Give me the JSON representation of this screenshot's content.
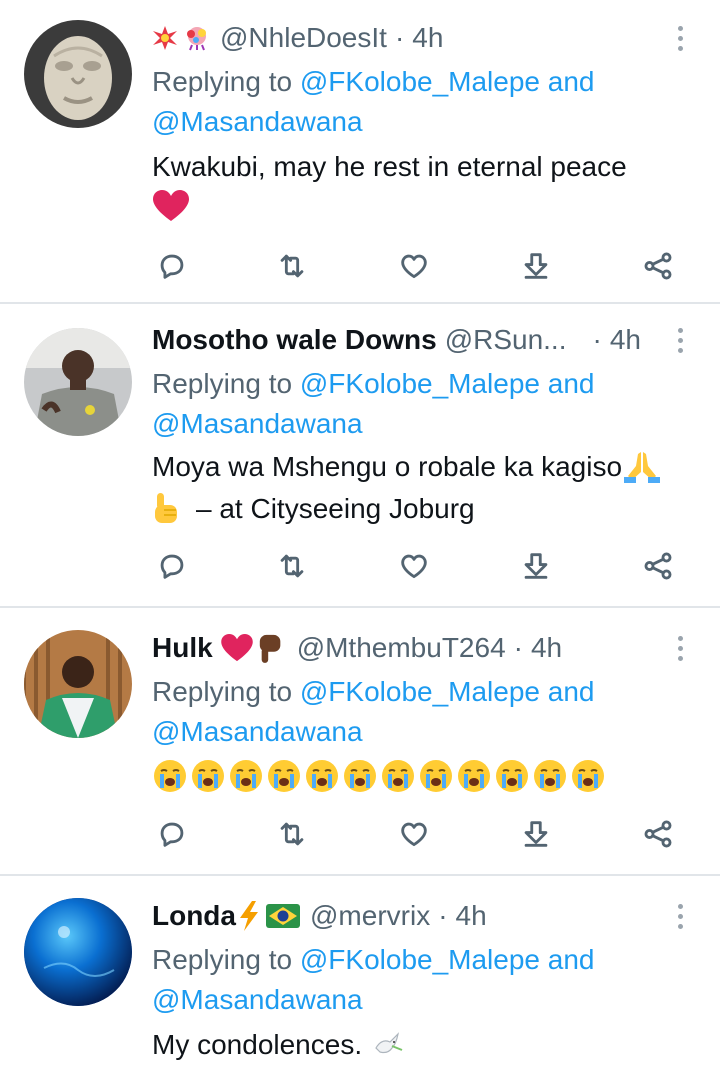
{
  "tweets": [
    {
      "display_name": "",
      "handle": "@NhleDoesIt",
      "time": "4h",
      "reply_prefix": "Replying to",
      "reply_to_1": "@FKolobe_Malepe",
      "reply_and": "and",
      "reply_to_2": "@Masandawana",
      "text_line1": "Kwakubi, may he rest in eternal peace",
      "text_line2": ""
    },
    {
      "display_name": "Mosotho wale Downs",
      "handle": "@RSun...",
      "time": "4h",
      "reply_prefix": "Replying to",
      "reply_to_1": "@FKolobe_Malepe",
      "reply_and": "and",
      "reply_to_2": "@Masandawana",
      "text_line1": "Moya wa Mshengu o robale ka kagiso",
      "text_line2": "– at Cityseeing Joburg"
    },
    {
      "display_name": "Hulk",
      "handle": "@MthembuT264",
      "time": "4h",
      "reply_prefix": "Replying to",
      "reply_to_1": "@FKolobe_Malepe",
      "reply_and": "and",
      "reply_to_2": "@Masandawana",
      "text_line1": "",
      "text_line2": ""
    },
    {
      "display_name": "Londa",
      "handle": "@mervrix",
      "time": "4h",
      "reply_prefix": "Replying to",
      "reply_to_1": "@FKolobe_Malepe",
      "reply_and": "and",
      "reply_to_2": "@Masandawana",
      "text_line1": "My condolences.",
      "text_line2": ""
    }
  ],
  "separator": "·",
  "icons": {
    "reply": "reply-icon",
    "retweet": "retweet-icon",
    "like": "like-icon",
    "bookmark": "bookmark-icon",
    "share": "share-icon",
    "more": "more-icon"
  },
  "colors": {
    "link": "#1d9bf0",
    "secondary_text": "#536471",
    "heart": "#e0245e"
  }
}
